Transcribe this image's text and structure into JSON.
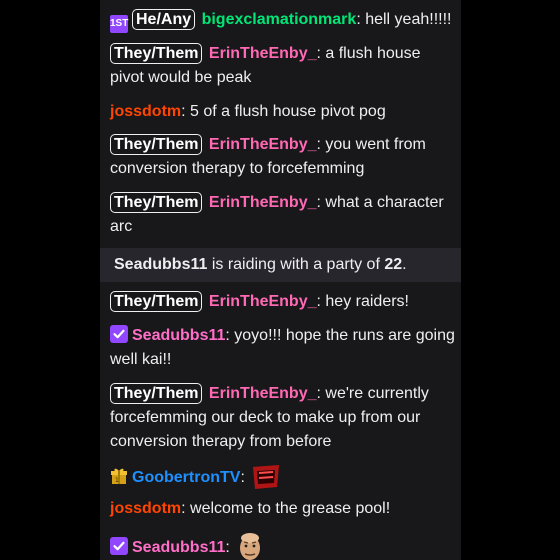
{
  "messages": [
    {
      "badge": "He/Any",
      "sub_badge": "1ST",
      "user": "bigexclamationmark",
      "user_color": "#00e676",
      "text": ": hell yeah!!!!!"
    },
    {
      "badge": "They/Them",
      "user": "ErinTheEnby_",
      "user_color": "#ff69b4",
      "text": ": a flush house pivot would be peak"
    },
    {
      "user": "jossdotm",
      "user_color": "#ff4500",
      "text": ": 5 of a flush house pivot pog"
    },
    {
      "badge": "They/Them",
      "user": "ErinTheEnby_",
      "user_color": "#ff69b4",
      "text": ": you went from conversion therapy to forcefemming"
    },
    {
      "badge": "They/Them",
      "user": "ErinTheEnby_",
      "user_color": "#ff69b4",
      "text": ": what a character arc"
    },
    {
      "badge": "They/Them",
      "user": "ErinTheEnby_",
      "user_color": "#ff69b4",
      "text": ": hey raiders!"
    },
    {
      "user": "Seadubbs11",
      "user_color": "#ff6ec7",
      "text": ": yoyo!!! hope the runs are going well kai!!"
    },
    {
      "badge": "They/Them",
      "user": "ErinTheEnby_",
      "user_color": "#ff69b4",
      "text": ": we're currently forcefemming our deck to make up from our conversion therapy from before"
    },
    {
      "user": "GoobertronTV",
      "user_color": "#1e90ff",
      "text": ":"
    },
    {
      "user": "jossdotm",
      "user_color": "#ff4500",
      "text": ": welcome to the grease pool!"
    },
    {
      "user": "Seadubbs11",
      "user_color": "#ff6ec7",
      "text": ":"
    }
  ],
  "raid": {
    "user": "Seadubbs11",
    "text_mid": " is raiding with a party of ",
    "count": "22",
    "text_end": "."
  },
  "icons": {
    "sub": "subscriber-1st-badge",
    "verified": "verified-check-badge",
    "gift": "gift-badge",
    "raid_emote": "raid-emote",
    "face_emote": "face-emote"
  },
  "colors": {
    "chat_bg": "#18181b",
    "raid_bg": "#26262c",
    "badge_purple": "#9146ff"
  }
}
